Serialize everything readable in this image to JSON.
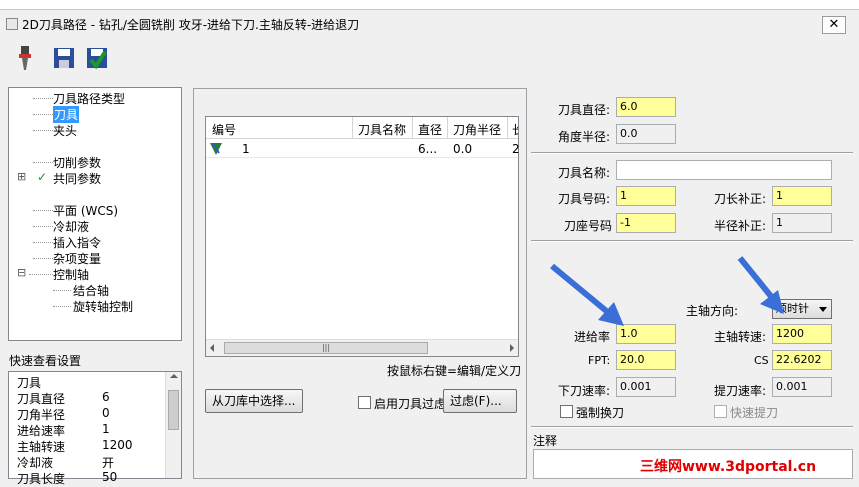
{
  "window": {
    "title": "2D刀具路径 - 钻孔/全圆铣削 攻牙-进给下刀.主轴反转-进给退刀",
    "close_label": "✕"
  },
  "colors": {
    "field_highlight": "#ffff99",
    "selected_item": "#3399ff",
    "arrow": "#3b6fd8",
    "watermark": "#e00000"
  },
  "toolbar": {
    "icons": [
      "tool-holder-icon",
      "save-icon",
      "apply-icon"
    ]
  },
  "tree": {
    "items": [
      {
        "label": "刀具路径类型"
      },
      {
        "label": "刀具",
        "selected": true
      },
      {
        "label": "夹头"
      },
      {
        "label": "切削参数"
      },
      {
        "label": "共同参数",
        "expander": "⊞",
        "check": "✓"
      },
      {
        "label": "平面 (WCS)"
      },
      {
        "label": "冷却液"
      },
      {
        "label": "插入指令"
      },
      {
        "label": "杂项变量"
      },
      {
        "label": "控制轴",
        "expander": "⊟"
      },
      {
        "label": "结合轴"
      },
      {
        "label": "旋转轴控制"
      }
    ]
  },
  "quickview": {
    "title": "快速查看设置",
    "rows": [
      {
        "k": "刀具",
        "v": ""
      },
      {
        "k": "刀具直径",
        "v": "6"
      },
      {
        "k": "刀角半径",
        "v": "0"
      },
      {
        "k": "进给速率",
        "v": "1"
      },
      {
        "k": "主轴转速",
        "v": "1200"
      },
      {
        "k": "冷却液",
        "v": "开"
      },
      {
        "k": "刀具长度",
        "v": "50"
      }
    ]
  },
  "tool_list": {
    "columns": [
      "编号",
      "刀具名称",
      "直径",
      "刀角半径",
      "长"
    ],
    "rows": [
      {
        "num": "1",
        "name": "",
        "dia": "6...",
        "cr": "0.0",
        "len": "2"
      }
    ],
    "scroll_thumb": "|||"
  },
  "hint": "按鼠标右键=编辑/定义刀",
  "buttons": {
    "library": "从刀库中选择...",
    "enable_filter": "启用刀具过虑",
    "filter": "过虑(F)..."
  },
  "tool_params": {
    "diameter": {
      "label": "刀具直径:",
      "value": "6.0"
    },
    "corner_radius": {
      "label": "角度半径:",
      "value": "0.0"
    },
    "name": {
      "label": "刀具名称:",
      "value": ""
    },
    "tool_number": {
      "label": "刀具号码:",
      "value": "1"
    },
    "length_offset": {
      "label": "刀长补正:",
      "value": "1"
    },
    "head_number": {
      "label": "刀座号码",
      "value": "-1"
    },
    "dia_offset": {
      "label": "半径补正:",
      "value": "1"
    },
    "spindle_dir": {
      "label": "主轴方向:",
      "value": "顺时针"
    },
    "feed_rate": {
      "label": "进给率",
      "value": "1.0"
    },
    "spindle_speed": {
      "label": "主轴转速:",
      "value": "1200"
    },
    "fpt": {
      "label": "FPT:",
      "value": "20.0"
    },
    "css": {
      "label": "CS",
      "value": "22.6202"
    },
    "plunge_rate": {
      "label": "下刀速率:",
      "value": "0.001"
    },
    "retract_rate": {
      "label": "提刀速率:",
      "value": "0.001"
    },
    "force_change": {
      "label": "强制换刀"
    },
    "rapid_retract": {
      "label": "快速提刀"
    },
    "comment": {
      "label": "注释"
    }
  },
  "watermark": "三维网www.3dportal.cn"
}
